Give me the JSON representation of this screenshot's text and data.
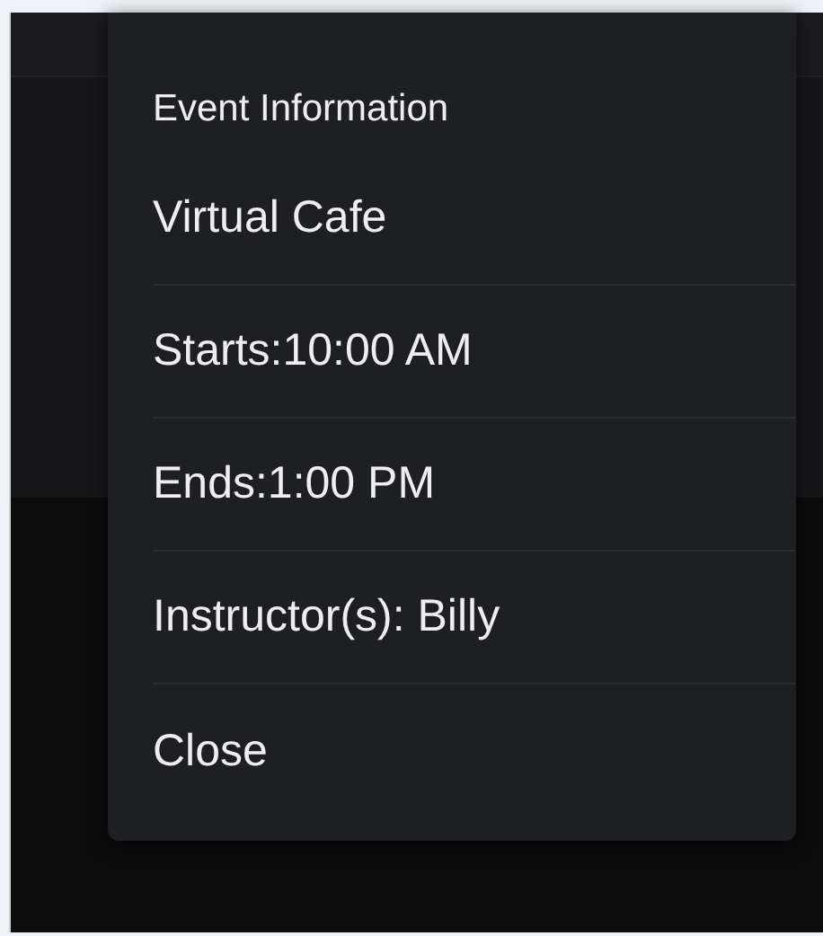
{
  "dialog": {
    "title": "Event Information",
    "details": [
      "Virtual Cafe",
      "Starts:10:00 AM",
      "Ends:1:00 PM",
      "Instructor(s): Billy"
    ],
    "close_button": "Close"
  }
}
